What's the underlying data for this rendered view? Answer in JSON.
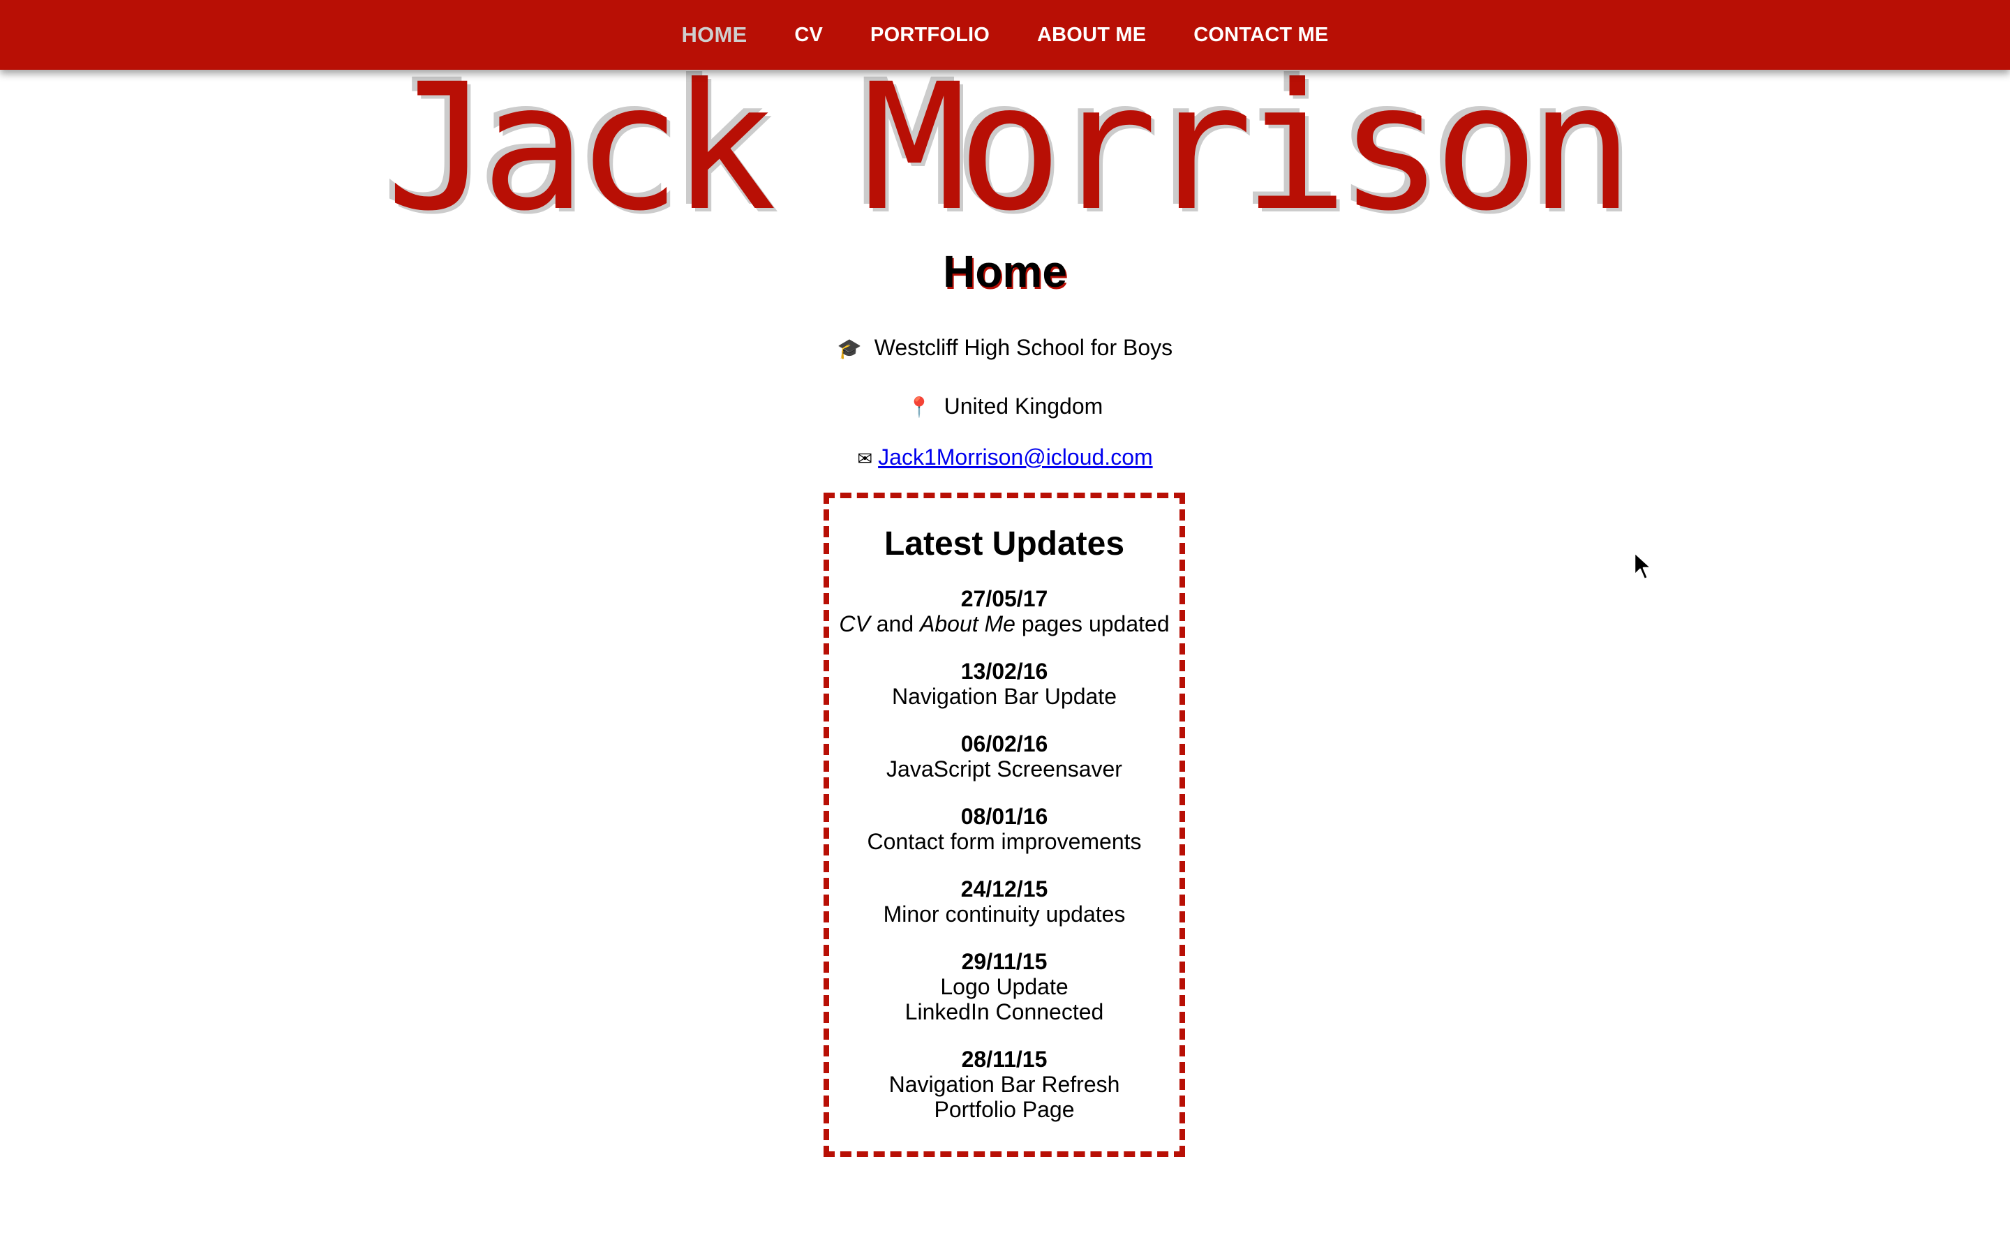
{
  "nav": {
    "items": [
      {
        "label": "HOME",
        "active": true
      },
      {
        "label": "CV",
        "active": false
      },
      {
        "label": "PORTFOLIO",
        "active": false
      },
      {
        "label": "ABOUT ME",
        "active": false
      },
      {
        "label": "CONTACT ME",
        "active": false
      }
    ]
  },
  "header": {
    "site_title": "Jack Morrison",
    "page_heading": "Home"
  },
  "info": {
    "school_icon": "graduation-cap-icon",
    "school": "Westcliff High School for Boys",
    "location_icon": "map-pin-icon",
    "location": "United Kingdom",
    "email_icon": "envelope-icon",
    "email": "Jack1Morrison@icloud.com"
  },
  "updates": {
    "title": "Latest Updates",
    "entries": [
      {
        "date": "27/05/17",
        "lines": [
          "CV and About Me pages updated"
        ]
      },
      {
        "date": "13/02/16",
        "lines": [
          "Navigation Bar Update"
        ]
      },
      {
        "date": "06/02/16",
        "lines": [
          "JavaScript Screensaver"
        ]
      },
      {
        "date": "08/01/16",
        "lines": [
          "Contact form improvements"
        ]
      },
      {
        "date": "24/12/15",
        "lines": [
          "Minor continuity updates"
        ]
      },
      {
        "date": "29/11/15",
        "lines": [
          "Logo Update",
          "LinkedIn Connected"
        ]
      },
      {
        "date": "28/11/15",
        "lines": [
          "Navigation Bar Refresh",
          "Portfolio Page"
        ]
      }
    ]
  },
  "colors": {
    "brand_red": "#b80f05",
    "nav_active": "#cfcfcf",
    "link_blue": "#0000ee"
  }
}
